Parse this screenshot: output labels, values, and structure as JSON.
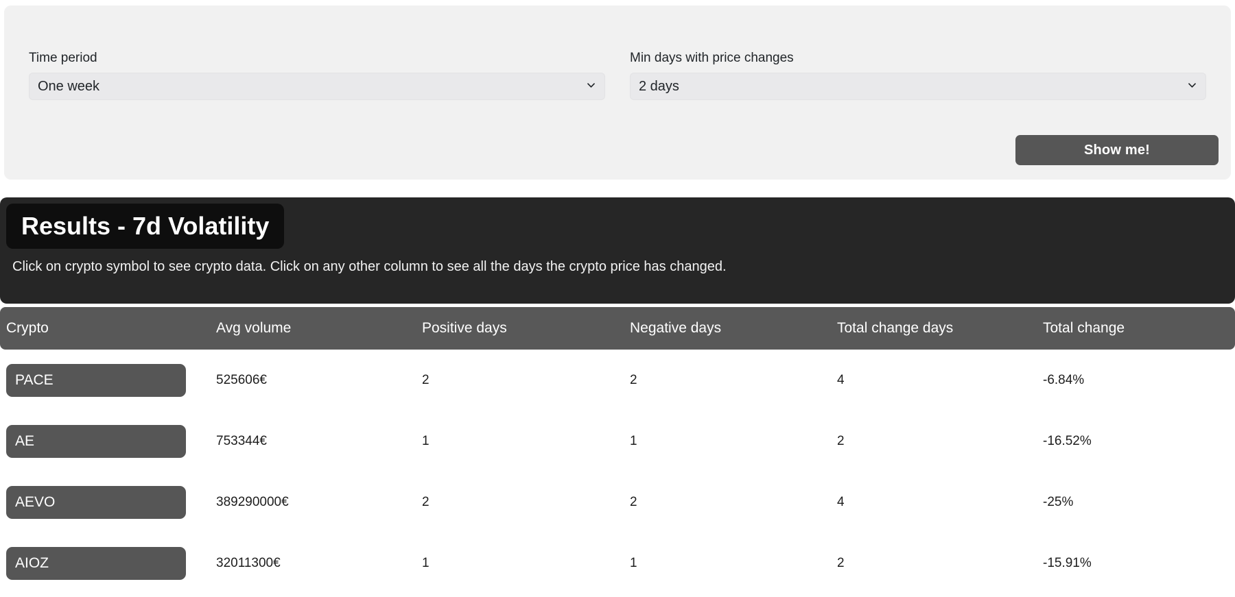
{
  "filters": {
    "time_period": {
      "label": "Time period",
      "value": "One week",
      "chevron_icon": "chevron-down-icon"
    },
    "min_days": {
      "label": "Min days with price changes",
      "value": "2 days",
      "chevron_icon": "chevron-down-icon"
    },
    "submit_label": "Show me!"
  },
  "results": {
    "title": "Results - 7d Volatility",
    "subtitle": "Click on crypto symbol to see crypto data. Click on any other column to see all the days the crypto price has changed.",
    "columns": [
      "Crypto",
      "Avg volume",
      "Positive days",
      "Negative days",
      "Total change days",
      "Total change"
    ],
    "rows": [
      {
        "crypto": "PACE",
        "avg_volume": "525606€",
        "positive_days": "2",
        "negative_days": "2",
        "total_change_days": "4",
        "total_change": "-6.84%"
      },
      {
        "crypto": "AE",
        "avg_volume": "753344€",
        "positive_days": "1",
        "negative_days": "1",
        "total_change_days": "2",
        "total_change": "-16.52%"
      },
      {
        "crypto": "AEVO",
        "avg_volume": "389290000€",
        "positive_days": "2",
        "negative_days": "2",
        "total_change_days": "4",
        "total_change": "-25%"
      },
      {
        "crypto": "AIOZ",
        "avg_volume": "32011300€",
        "positive_days": "1",
        "negative_days": "1",
        "total_change_days": "2",
        "total_change": "-15.91%"
      }
    ]
  },
  "colors": {
    "panel_bg": "#f1f1f1",
    "select_bg": "#e9e9eb",
    "button_bg": "#565656",
    "results_panel_bg": "#262626",
    "results_title_bg": "#0e0e0e",
    "table_head_bg": "#585858",
    "page_bg": "#ffffff"
  }
}
